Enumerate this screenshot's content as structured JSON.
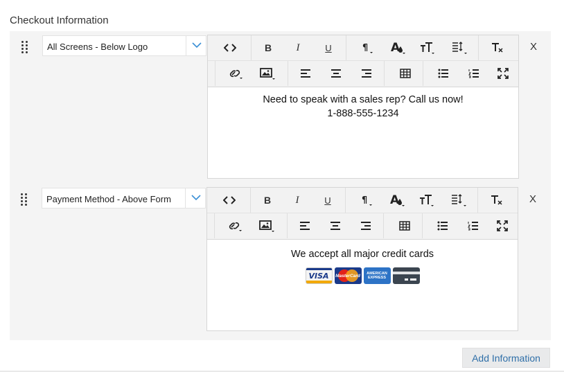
{
  "section": {
    "title": "Checkout Information"
  },
  "rows": [
    {
      "select_value": "All Screens - Below Logo",
      "content_lines": [
        "Need to speak with a sales rep? Call us now!",
        "1-888-555-1234"
      ],
      "remove_label": "X"
    },
    {
      "select_value": "Payment Method - Above Form",
      "content_lines": [
        "We accept all major credit cards"
      ],
      "cards": [
        {
          "icon": "visa-card-icon",
          "label": "VISA"
        },
        {
          "icon": "mastercard-card-icon",
          "label": "MasterCard"
        },
        {
          "icon": "amex-card-icon",
          "label_top": "AMERICAN",
          "label_bottom": "EXPRESS"
        },
        {
          "icon": "generic-card-icon"
        }
      ],
      "remove_label": "X"
    }
  ],
  "toolbar": {
    "icons": [
      "code-view-icon",
      "bold-icon",
      "italic-icon",
      "underline-icon",
      "paragraph-format-icon",
      "text-color-icon",
      "font-size-icon",
      "line-height-icon",
      "clear-format-icon",
      "link-icon",
      "image-icon",
      "align-left-icon",
      "align-center-icon",
      "align-right-icon",
      "table-icon",
      "bulleted-list-icon",
      "numbered-list-icon",
      "fullscreen-icon"
    ],
    "bold_glyph": "B",
    "italic_glyph": "I",
    "underline_glyph": "U",
    "paragraph_glyph": "¶",
    "code_glyph": "<>",
    "clear_glyph": "T",
    "clear_sub": "x",
    "font_size_glyph": "TT",
    "text_color_glyph": "A"
  },
  "footer": {
    "add_button_label": "Add Information"
  },
  "colors": {
    "accent": "#2f6fa8",
    "panel_bg": "#f4f4f4",
    "toolbar_bg": "#f2f2f2"
  }
}
